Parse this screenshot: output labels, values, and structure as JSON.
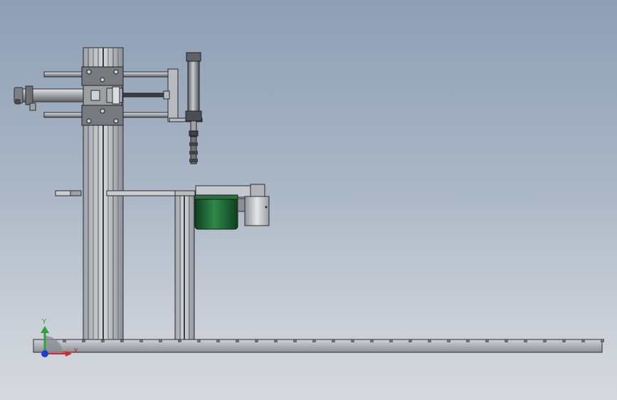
{
  "view": {
    "colors": {
      "background_top": "#8e9fb5",
      "background_bottom": "#d6d9de",
      "metal_light": "#d4d6d9",
      "metal_mid": "#a7abb0",
      "metal_dark": "#5a5e63",
      "motor_green": "#1f6b35",
      "outline": "#2a2c30"
    }
  },
  "triad": {
    "x_label": "X",
    "y_label": "Y",
    "x_color": "#d9262a",
    "y_color": "#2fa33a",
    "z_color": "#1d3fd1"
  }
}
